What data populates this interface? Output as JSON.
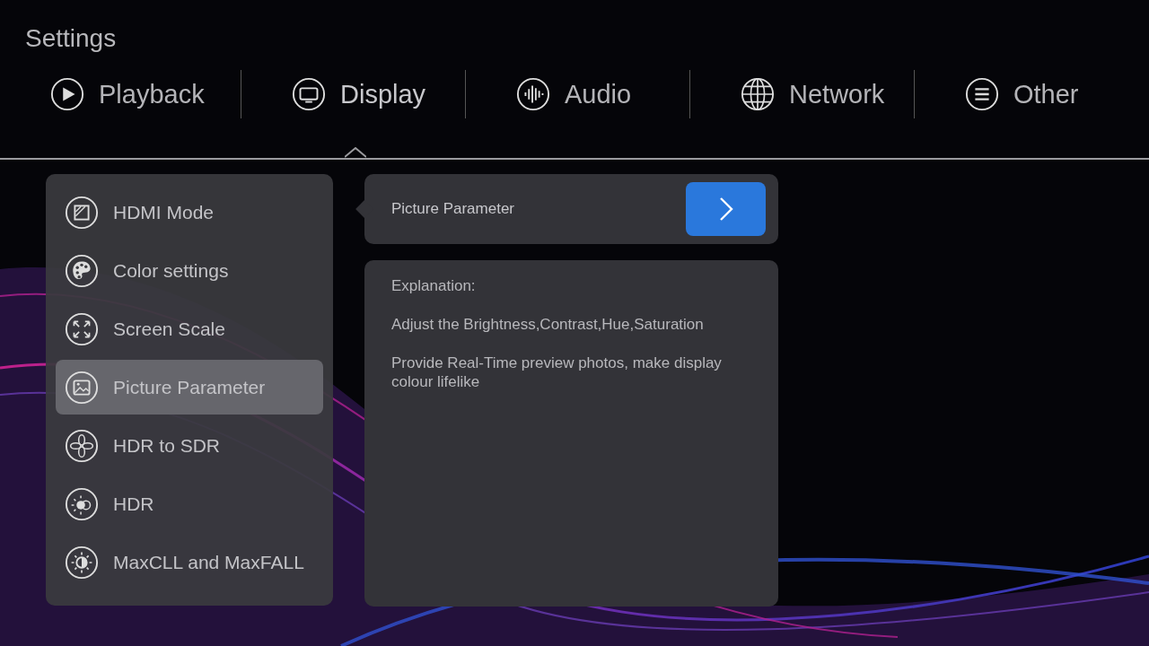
{
  "header": {
    "title": "Settings"
  },
  "tabs": [
    {
      "label": "Playback",
      "selected": false
    },
    {
      "label": "Display",
      "selected": true
    },
    {
      "label": "Audio",
      "selected": false
    },
    {
      "label": "Network",
      "selected": false
    },
    {
      "label": "Other",
      "selected": false
    }
  ],
  "sidebar": {
    "items": [
      {
        "label": "HDMI Mode",
        "selected": false
      },
      {
        "label": "Color settings",
        "selected": false
      },
      {
        "label": "Screen Scale",
        "selected": false
      },
      {
        "label": "Picture Parameter",
        "selected": true
      },
      {
        "label": "HDR to SDR",
        "selected": false
      },
      {
        "label": "HDR",
        "selected": false
      },
      {
        "label": "MaxCLL and MaxFALL",
        "selected": false
      }
    ]
  },
  "detail": {
    "option": {
      "label": "Picture Parameter"
    },
    "explanation": {
      "heading": "Explanation:",
      "paragraphs": [
        "Adjust the Brightness,Contrast,Hue,Saturation",
        "Provide Real-Time preview photos, make display colour lifelike"
      ]
    }
  }
}
